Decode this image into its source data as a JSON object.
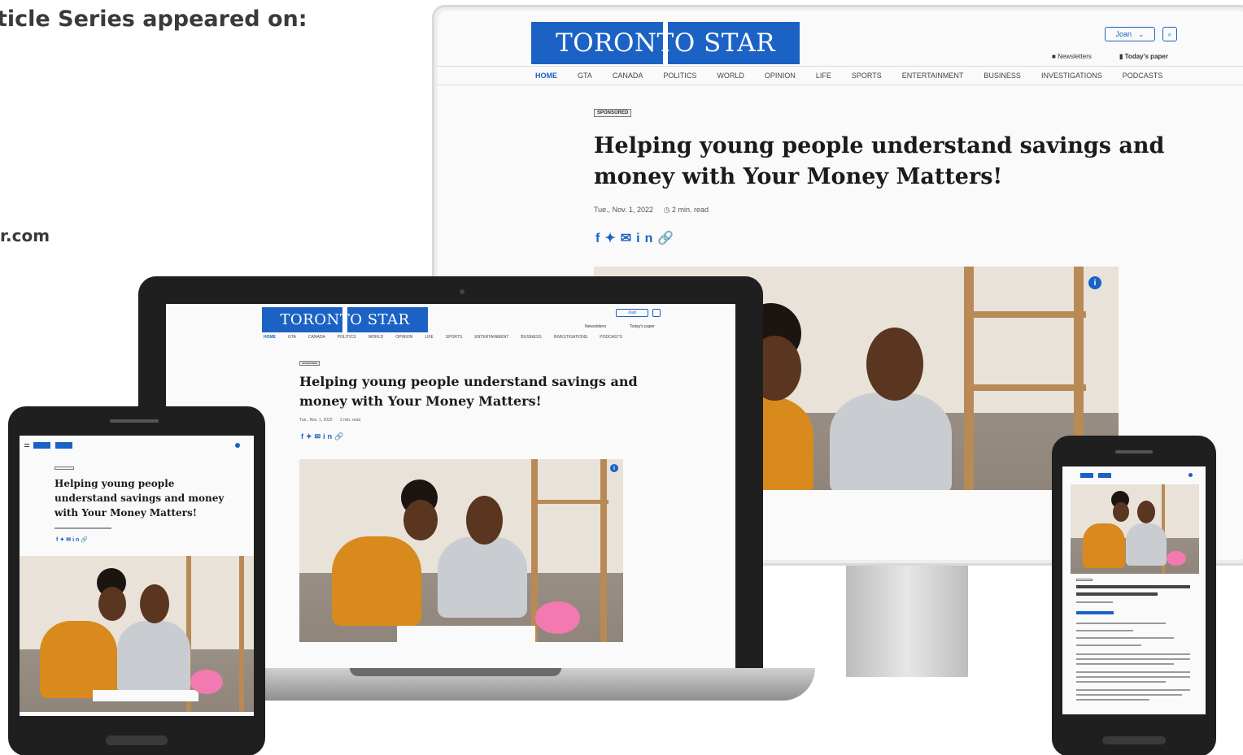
{
  "left_panel": {
    "heading": "ticle Series appeared on:",
    "site": "r.com"
  },
  "site": {
    "logo_text": "TORONTO STAR",
    "brand_color": "#1b62c4",
    "user_label": "Joan",
    "newsletters": "Newsletters",
    "todays_paper": "Today's paper",
    "nav": [
      "HOME",
      "GTA",
      "CANADA",
      "POLITICS",
      "WORLD",
      "OPINION",
      "LIFE",
      "SPORTS",
      "ENTERTAINMENT",
      "BUSINESS",
      "INVESTIGATIONS",
      "PODCASTS"
    ],
    "sponsored": "SPONSORED",
    "headline_line1": "Helping young people understand savings and",
    "headline_line2": "money with Your Money Matters!",
    "date": "Tue., Nov. 1, 2022",
    "read_time": "2 min. read",
    "info_icon": "info-icon",
    "social_icons": [
      "facebook-icon",
      "twitter-icon",
      "email-icon",
      "linkedin-icon",
      "link-icon"
    ]
  },
  "tablet": {
    "headline_line1": "Helping young people",
    "headline_line2": "understand savings and money",
    "headline_line3": "with Your Money Matters!"
  }
}
